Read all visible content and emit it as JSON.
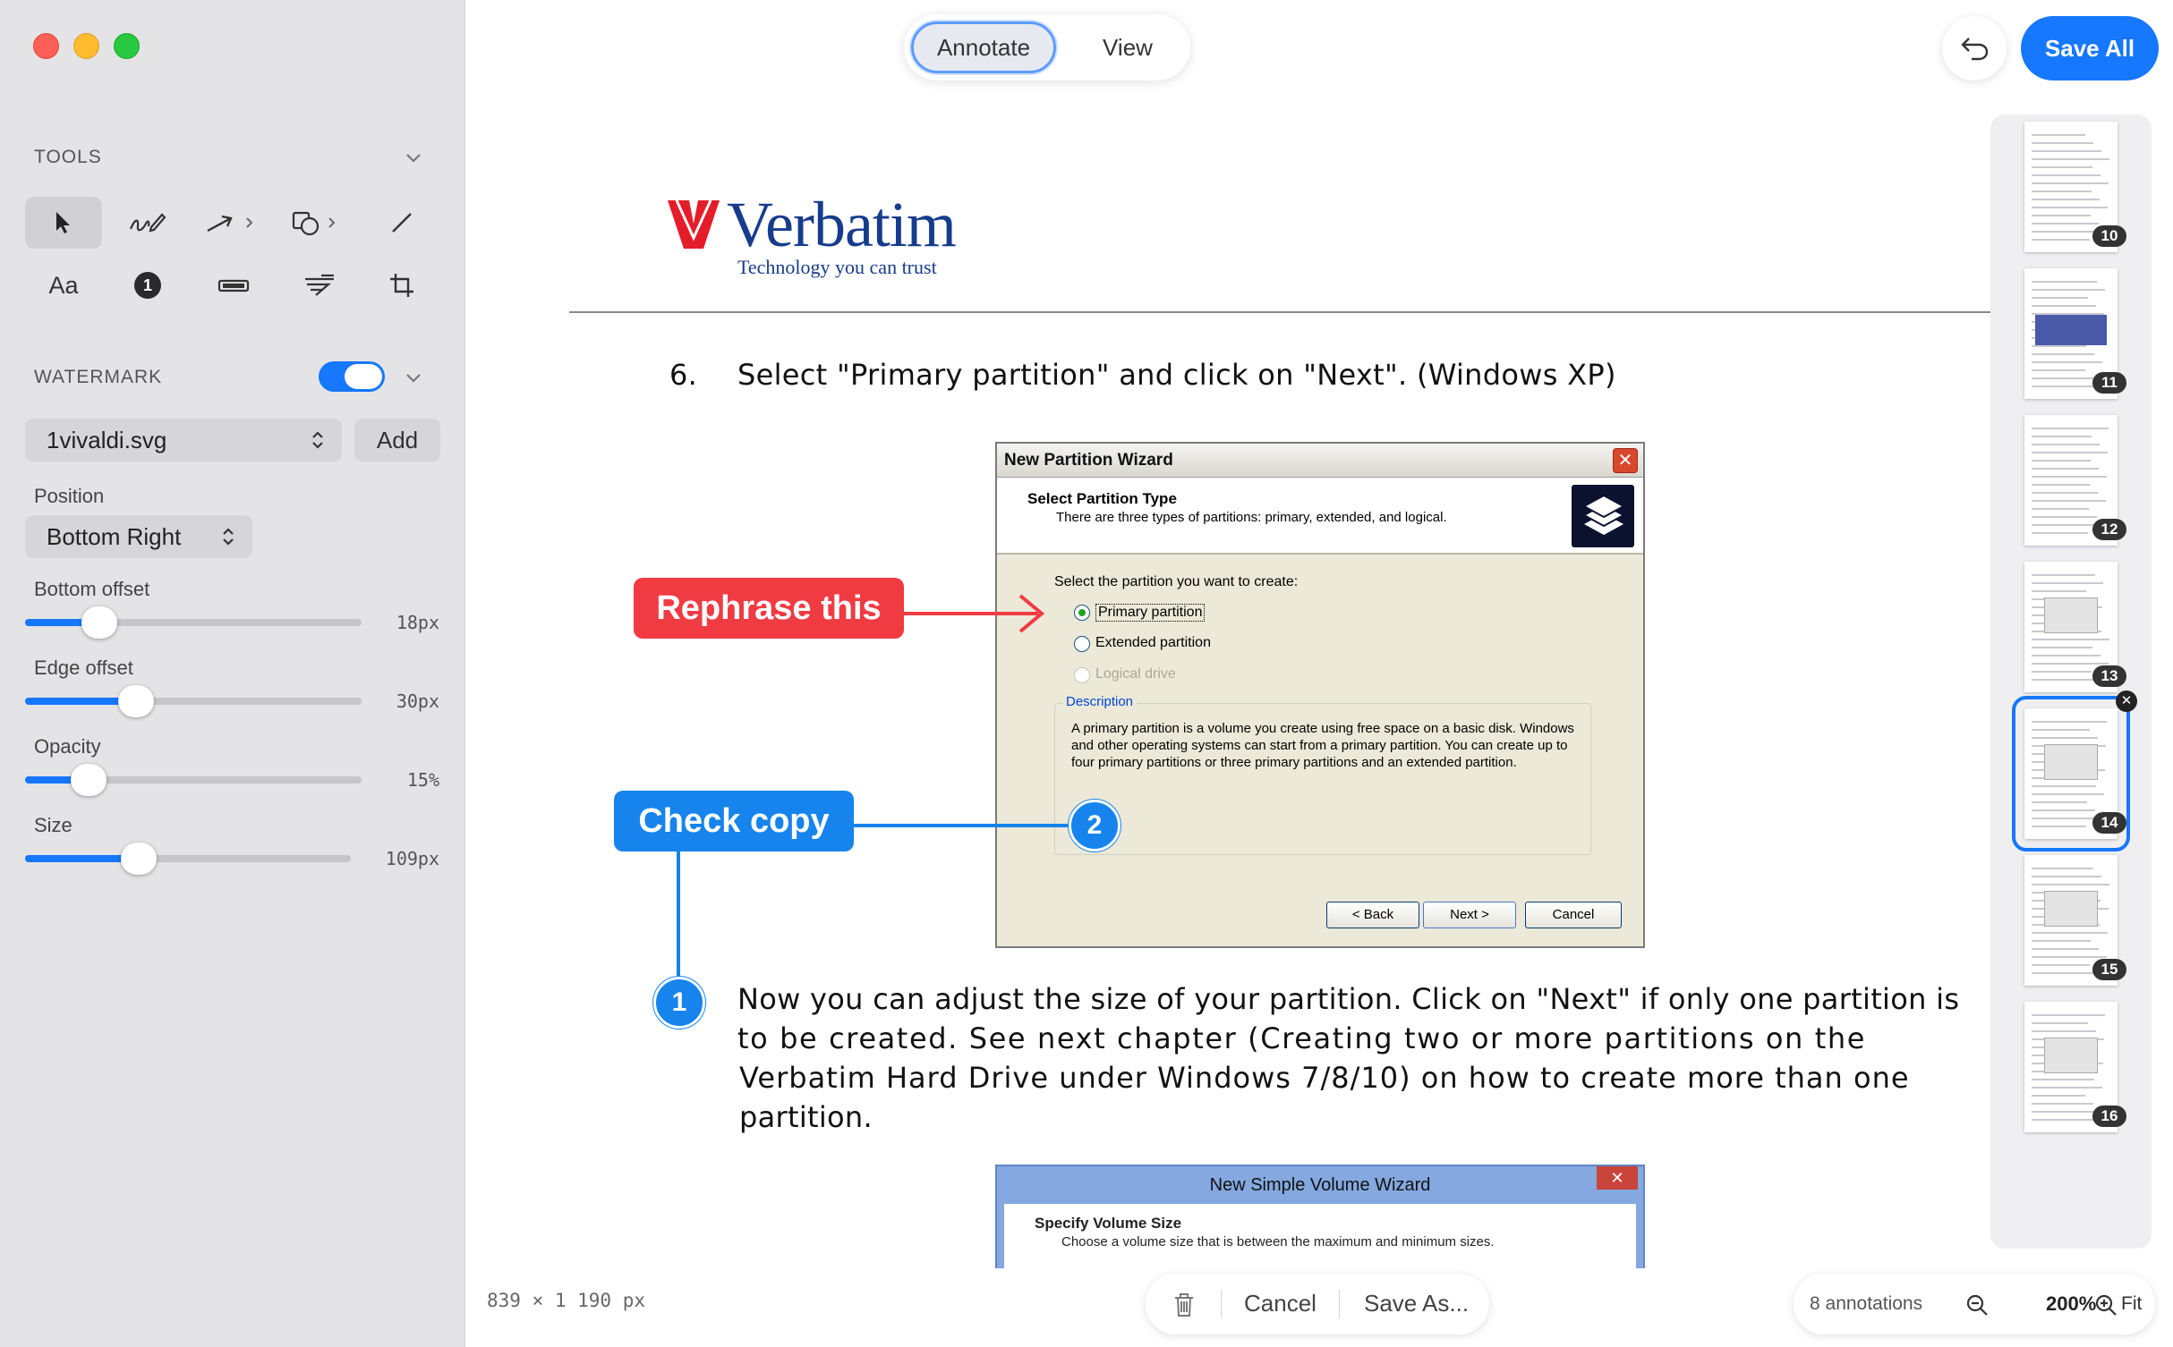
{
  "sidebar": {
    "tools_title": "TOOLS",
    "text_tool_label": "Aa",
    "counter_tool_label": "1",
    "watermark_title": "WATERMARK",
    "watermark_enabled": true,
    "watermark_file": "1vivaldi.svg",
    "add_label": "Add",
    "position_label": "Position",
    "position_value": "Bottom Right",
    "sliders": [
      {
        "label": "Bottom offset",
        "value_text": "18px",
        "fraction": 0.22
      },
      {
        "label": "Edge offset",
        "value_text": "30px",
        "fraction": 0.33
      },
      {
        "label": "Opacity",
        "value_text": "15%",
        "fraction": 0.19
      },
      {
        "label": "Size",
        "value_text": "109px",
        "fraction": 0.35
      }
    ]
  },
  "toolbar": {
    "annotate_label": "Annotate",
    "view_label": "View",
    "save_all_label": "Save All"
  },
  "document": {
    "logo_word": "Verbatim",
    "logo_tagline": "Technology you can trust",
    "step_number": "6.",
    "step_text": "Select \"Primary partition\" and click on \"Next\". (Windows XP)",
    "paragraph_lines": [
      "Now you can adjust the size of your partition. Click on \"Next\" if only one partition is",
      "to be created. See next chapter (Creating two or more partitions on the",
      "Verbatim Hard Drive under Windows 7/8/10) on how to create more than one",
      "partition."
    ],
    "wizard": {
      "title": "New Partition Wizard",
      "close": "✕",
      "header_title": "Select Partition Type",
      "header_sub": "There are three types of partitions: primary, extended, and logical.",
      "prompt": "Select the partition you want to create:",
      "options": [
        "Primary partition",
        "Extended partition",
        "Logical drive"
      ],
      "group_title": "Description",
      "description": "A primary partition is a volume you create using free space on a basic disk. Windows and other operating systems can start from a primary partition. You can create up to four primary partitions or three primary partitions and an extended partition.",
      "back": "< Back",
      "next": "Next >",
      "cancel": "Cancel"
    },
    "wizard2": {
      "title": "New Simple Volume Wizard",
      "close": "✕",
      "header_title": "Specify Volume Size",
      "header_sub": "Choose a volume size that is between the maximum and minimum sizes."
    }
  },
  "annotations": {
    "callout_red": "Rephrase this",
    "callout_blue": "Check copy",
    "badge_1": "1",
    "badge_2": "2",
    "red_color": "#f03b42",
    "blue_color": "#1684ec"
  },
  "thumbnails": [
    {
      "page": "10",
      "selected": false
    },
    {
      "page": "11",
      "selected": false
    },
    {
      "page": "12",
      "selected": false
    },
    {
      "page": "13",
      "selected": false
    },
    {
      "page": "14",
      "selected": true
    },
    {
      "page": "15",
      "selected": false
    },
    {
      "page": "16",
      "selected": false
    }
  ],
  "thumb_remove": "✕",
  "status": {
    "dimensions": "839 × 1 190 px",
    "cancel_label": "Cancel",
    "save_as_label": "Save As...",
    "annotations_count": "8 annotations",
    "zoom_level": "200%",
    "fit_label": "Fit"
  },
  "colors": {
    "accent": "#1677ff",
    "sidebar_bg": "#e4e4e7"
  }
}
